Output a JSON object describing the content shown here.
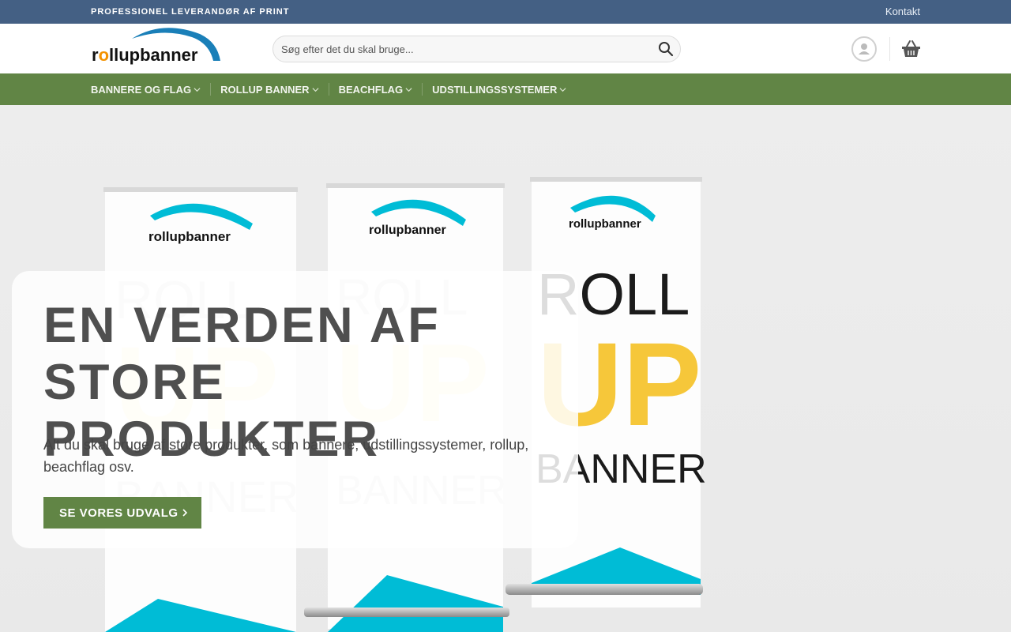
{
  "topbar": {
    "tagline": "PROFESSIONEL LEVERANDØR AF PRINT",
    "contact_link": "Kontakt"
  },
  "header": {
    "logo_text": "rollupbanner",
    "search_placeholder": "Søg efter det du skal bruge...",
    "icons": [
      "search-icon",
      "account-icon",
      "cart-basket-icon"
    ]
  },
  "nav": {
    "items": [
      {
        "label": "BANNERE OG FLAG"
      },
      {
        "label": "ROLLUP BANNER"
      },
      {
        "label": "BEACHFLAG"
      },
      {
        "label": "UDSTILLINGSSYSTEMER"
      }
    ]
  },
  "hero": {
    "title_line1": "EN VERDEN AF",
    "title_line2": "STORE PRODUKTER",
    "text": "Alt du skal bruge af store produkter, som bannere, udstillingssystemer, rollup, beachflag osv.",
    "button_label": "SE VORES UDVALG",
    "banner_logo_text": "rollupbanner",
    "banner_word1": "ROLL",
    "banner_word2": "UP",
    "banner_word3": "BANNER"
  },
  "colors": {
    "topbar": "#446084",
    "nav": "#618545",
    "button": "#618545",
    "logo_arc": "#1a7fb8",
    "logo_o": "#f39200",
    "banner_cyan": "#00bcd6",
    "banner_yellow": "#f6c73a"
  }
}
